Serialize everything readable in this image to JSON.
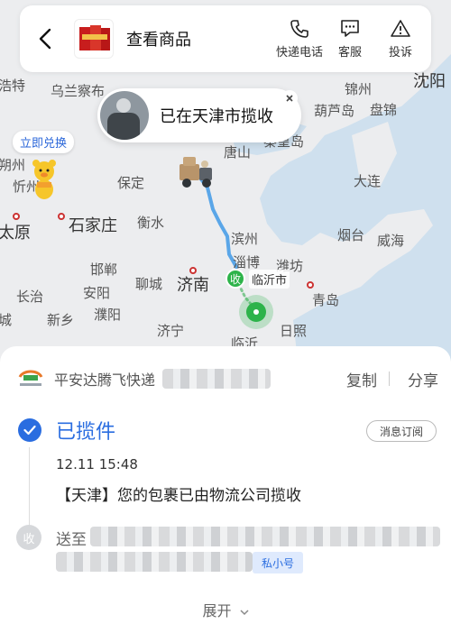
{
  "header": {
    "back_icon": "chevron-left-icon",
    "title": "查看商品",
    "actions": [
      {
        "label": "快递电话",
        "icon": "phone-icon"
      },
      {
        "label": "客服",
        "icon": "chat-icon"
      },
      {
        "label": "投诉",
        "icon": "warning-icon"
      }
    ]
  },
  "map": {
    "status_bubble": "已在天津市揽收",
    "redeem_label": "立即兑换",
    "destination_badge": "收",
    "destination_label": "临沂市",
    "route_color": "#5aa6e8",
    "cities": [
      "浩特",
      "乌兰察布",
      "锦州",
      "沈阳",
      "葫芦岛",
      "盘锦",
      "朔州",
      "忻州",
      "保定",
      "唐山",
      "秦皇岛",
      "石家庄",
      "衡水",
      "大连",
      "太原",
      "滨州",
      "烟台",
      "威海",
      "淄博",
      "潍坊",
      "邯郸",
      "聊城",
      "济南",
      "长治",
      "安阳",
      "青岛",
      "城",
      "新乡",
      "濮阳",
      "济宁",
      "日照",
      "临沂"
    ]
  },
  "courier": {
    "name": "平安达腾飞快递",
    "copy_label": "复制",
    "share_label": "分享"
  },
  "tracking": {
    "status": "已揽件",
    "subscribe_label": "消息订阅",
    "time": "12.11 15:48",
    "event": "【天津】您的包裹已由物流公司揽收",
    "receive_badge": "收",
    "send_to_label": "送至",
    "privacy_label": "私小号",
    "expand_label": "展开"
  },
  "colors": {
    "accent": "#2a6de0",
    "green": "#2db34a"
  }
}
